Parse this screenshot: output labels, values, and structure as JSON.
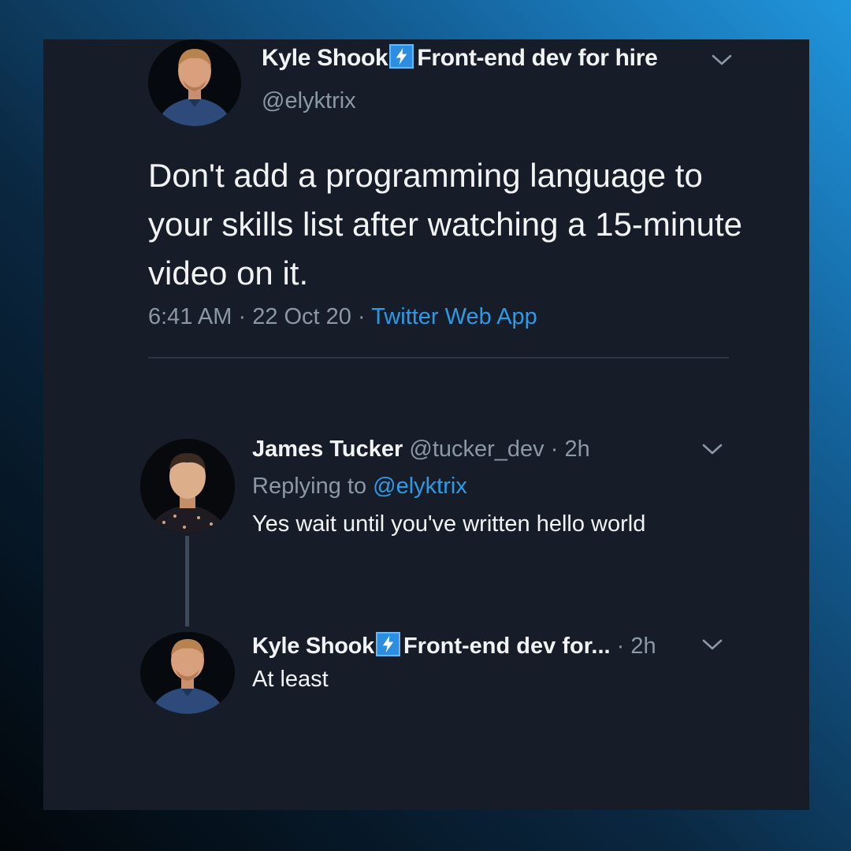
{
  "main_tweet": {
    "display_name": "Kyle Shook",
    "name_suffix": "Front-end dev for hire",
    "handle": "@elyktrix",
    "text": "Don't add a programming language to your skills list after watching a 15-minute video on it.",
    "time": "6:41 AM",
    "separator": " · ",
    "date": "22 Oct 20",
    "source": "Twitter Web App"
  },
  "reply": {
    "display_name": "James Tucker",
    "handle": "@tucker_dev",
    "time_ago": "2h",
    "separator": " · ",
    "replying_prefix": "Replying to ",
    "replying_to": "@elyktrix",
    "text": "Yes wait until you've written hello world"
  },
  "reply2": {
    "display_name": "Kyle Shook",
    "name_suffix": "Front-end dev for...",
    "time_ago": "2h",
    "separator": " · ",
    "text": "At least"
  },
  "icons": {
    "badge": "lightning-bolt-icon",
    "menu": "chevron-down-icon"
  },
  "colors": {
    "panel_bg": "#171d28",
    "text_primary": "#f2f3f5",
    "text_secondary": "#8b98a5",
    "link": "#2b9be9",
    "badge_bg": "#2b8ee0"
  }
}
